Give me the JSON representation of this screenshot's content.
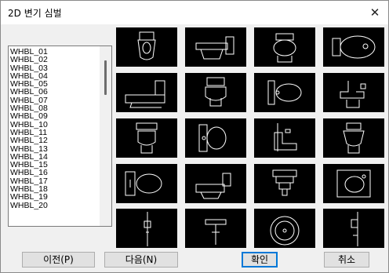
{
  "dialog": {
    "title": "2D 변기 심벌"
  },
  "list": {
    "items": [
      "WHBL_01",
      "WHBL_02",
      "WHBL_03",
      "WHBL_04",
      "WHBL_05",
      "WHBL_06",
      "WHBL_07",
      "WHBL_08",
      "WHBL_09",
      "WHBL_10",
      "WHBL_11",
      "WHBL_12",
      "WHBL_13",
      "WHBL_14",
      "WHBL_15",
      "WHBL_16",
      "WHBL_17",
      "WHBL_18",
      "WHBL_19",
      "WHBL_20"
    ]
  },
  "buttons": {
    "prev_label": "이전(P)",
    "next_label": "다음(N)",
    "ok_label": "확인",
    "cancel_label": "취소"
  },
  "thumbnails": {
    "count": 20,
    "background": "#000000",
    "stroke": "#ffffff"
  },
  "colors": {
    "default_button_border": "#0078d7"
  }
}
